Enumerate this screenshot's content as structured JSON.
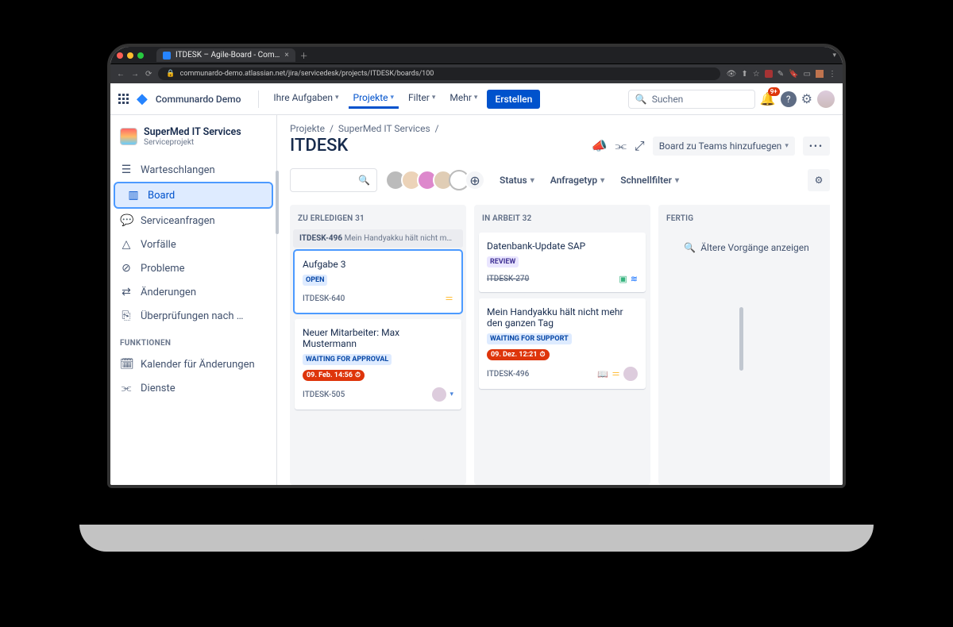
{
  "browser": {
    "tab_title": "ITDESK – Agile-Board - Com…",
    "url": "communardo-demo.atlassian.net/jira/servicedesk/projects/ITDESK/boards/100"
  },
  "topnav": {
    "brand": "Communardo Demo",
    "items": {
      "your_work": "Ihre Aufgaben",
      "projects": "Projekte",
      "filters": "Filter",
      "more": "Mehr"
    },
    "create": "Erstellen",
    "search_placeholder": "Suchen",
    "notif_badge": "9+"
  },
  "sidebar": {
    "project_name": "SuperMed IT Services",
    "project_type": "Serviceprojekt",
    "items": [
      {
        "icon": "☰",
        "label": "Warteschlangen"
      },
      {
        "icon": "▥",
        "label": "Board",
        "active": true
      },
      {
        "icon": "💬",
        "label": "Serviceanfragen"
      },
      {
        "icon": "△",
        "label": "Vorfälle"
      },
      {
        "icon": "⊘",
        "label": "Probleme"
      },
      {
        "icon": "⇄",
        "label": "Änderungen"
      },
      {
        "icon": "⎘",
        "label": "Überprüfungen nach …"
      }
    ],
    "section": "FUNKTIONEN",
    "fn_items": [
      {
        "icon": "🗓",
        "label": "Kalender für Änderungen"
      },
      {
        "icon": "⫘",
        "label": "Dienste"
      }
    ]
  },
  "main": {
    "crumbs": [
      "Projekte",
      "SuperMed IT Services"
    ],
    "title": "ITDESK",
    "add_to_teams": "Board zu Teams hinzufuegen",
    "filters": {
      "status": "Status",
      "reqtype": "Anfragetyp",
      "quick": "Schnellfilter"
    }
  },
  "columns": [
    {
      "head": "ZU ERLEDIGEN 31",
      "sticky_key": "ITDESK-496",
      "sticky_text": "Mein Handyakku hält nicht m…",
      "cards": [
        {
          "title": "Aufgabe 3",
          "status": "OPEN",
          "status_cls": "lz-open",
          "key": "ITDESK-640",
          "selected": true,
          "prio": "="
        },
        {
          "title": "Neuer Mitarbeiter: Max Mustermann",
          "status": "WAITING FOR APPROVAL",
          "status_cls": "lz-wait",
          "due": "09. Feb. 14:56",
          "key": "ITDESK-505",
          "assignee": true,
          "chev": true
        }
      ]
    },
    {
      "head": "IN ARBEIT 32",
      "cards": [
        {
          "title": "Datenbank-Update SAP",
          "status": "REVIEW",
          "status_cls": "lz-review",
          "key": "ITDESK-270",
          "key_done": true,
          "extra_icons": true
        },
        {
          "title": "Mein Handyakku hält nicht mehr den ganzen Tag",
          "status": "WAITING FOR SUPPORT",
          "status_cls": "lz-wait",
          "due": "09. Dez. 12:21",
          "key": "ITDESK-496",
          "book": true,
          "prio": "=",
          "assignee": true
        }
      ]
    },
    {
      "head": "FERTIG",
      "done_text": "Ältere Vorgänge anzeigen"
    }
  ]
}
